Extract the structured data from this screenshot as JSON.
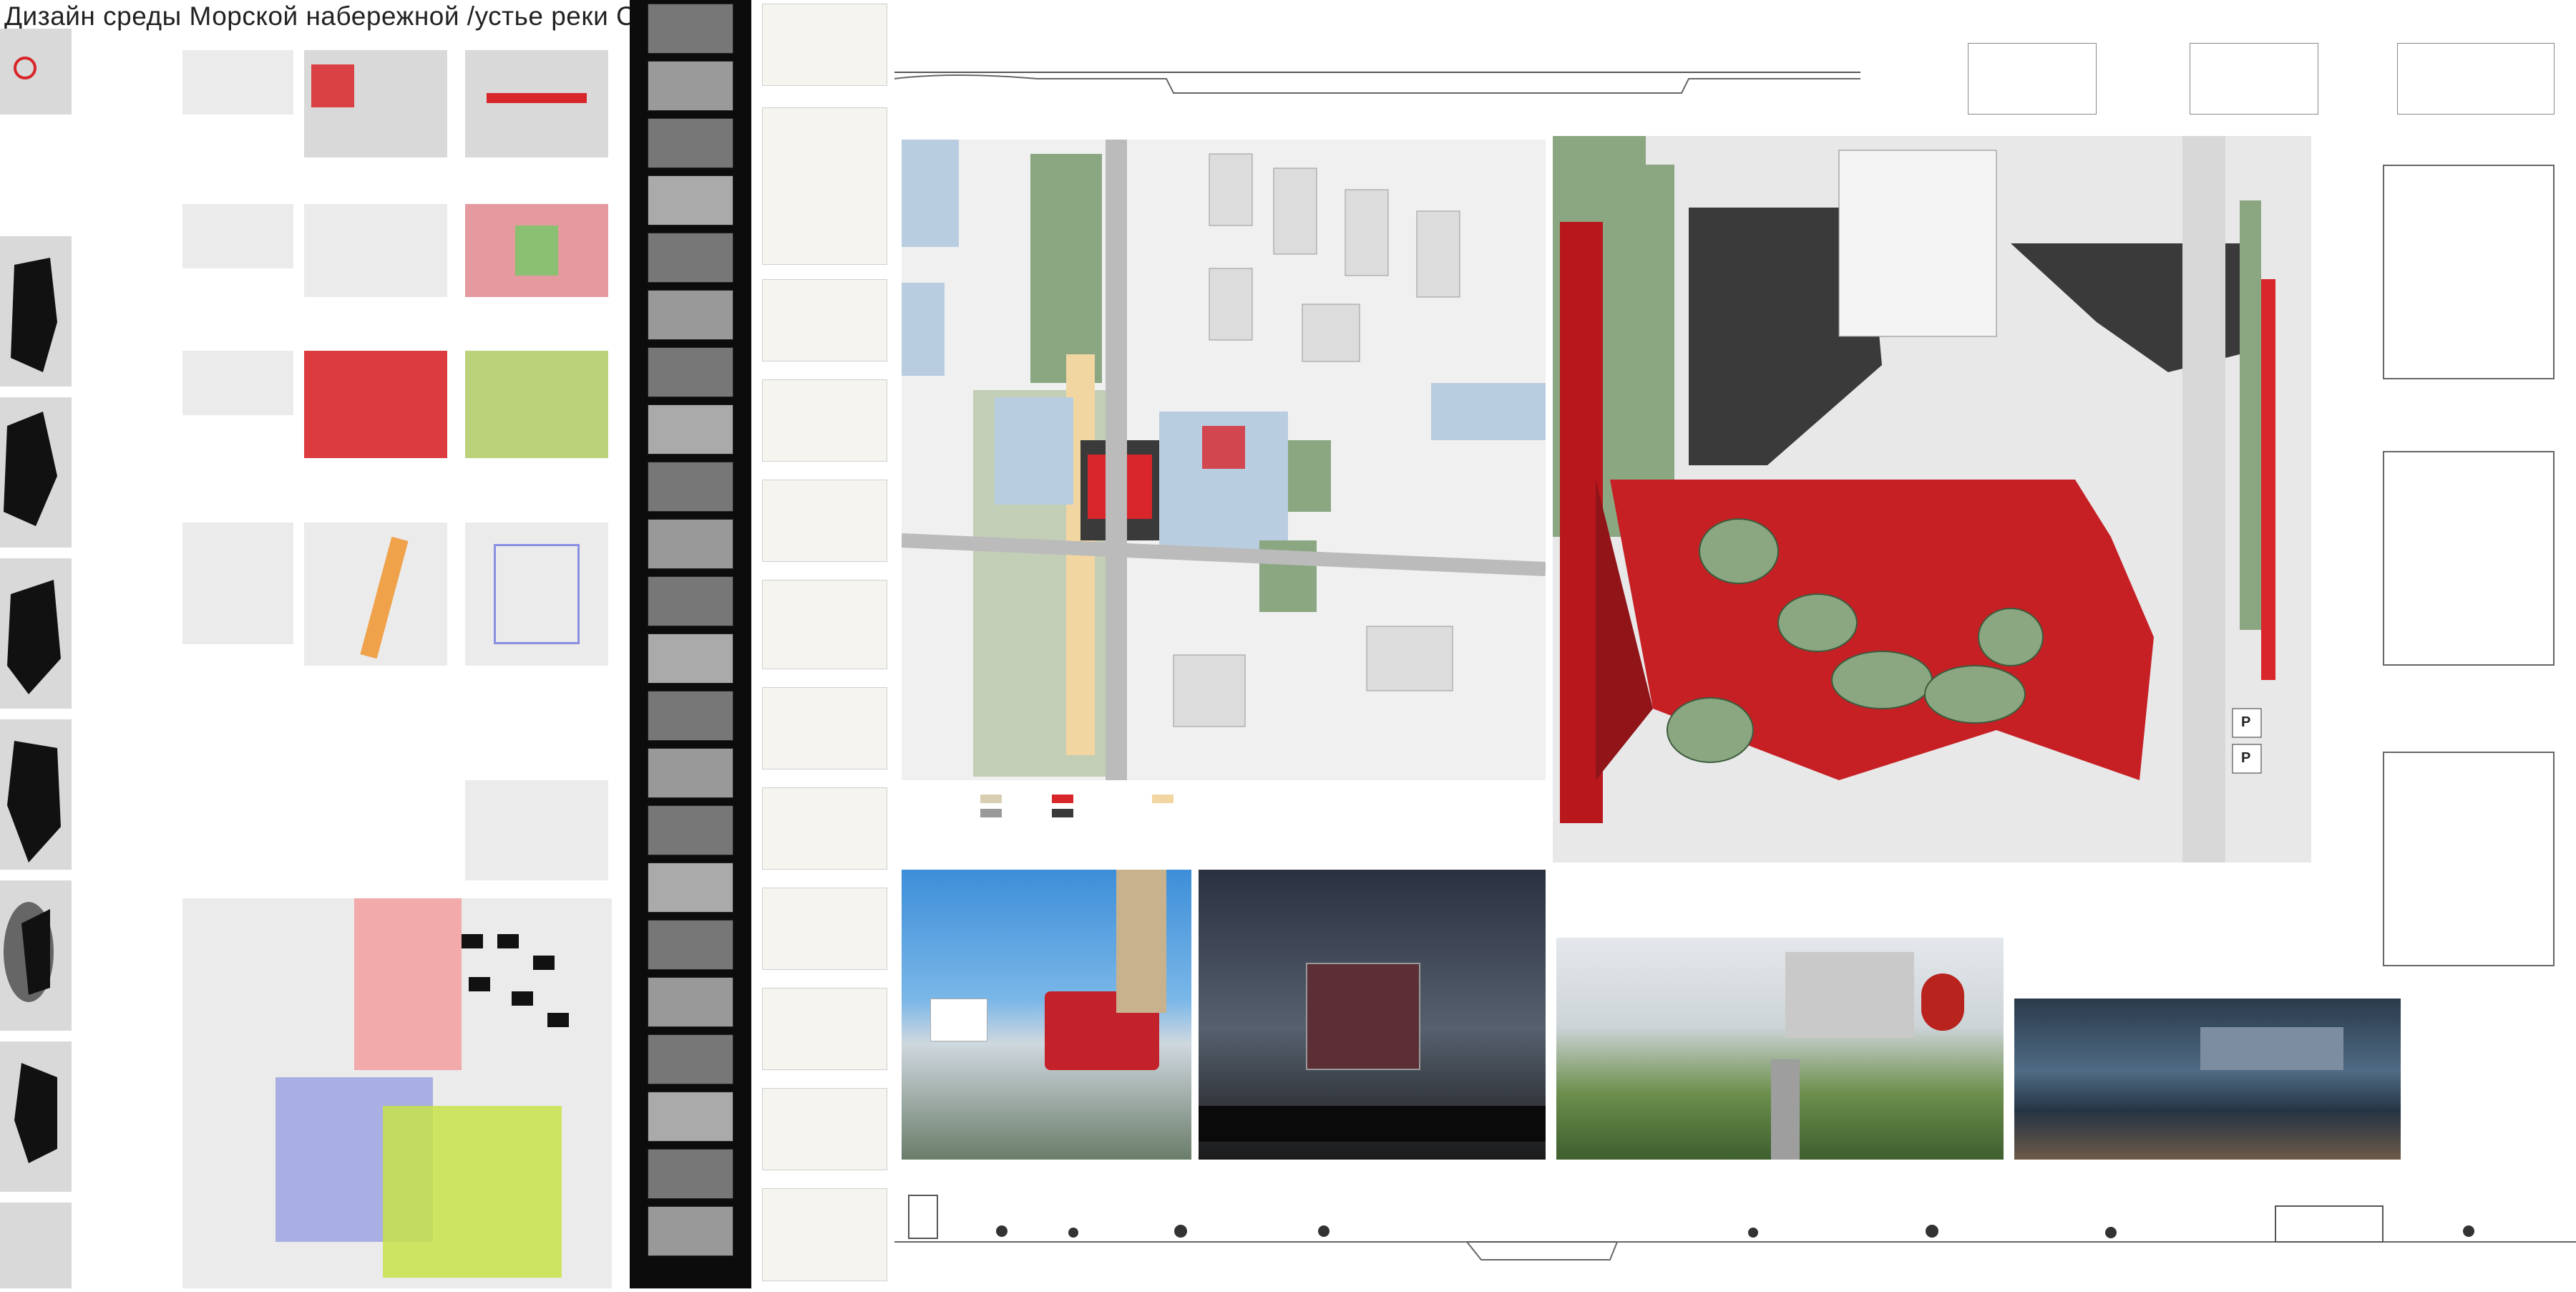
{
  "board": {
    "title": "Дизайн среды Морской набережной /устье реки Смоленки/",
    "parking_label_1": "P",
    "parking_label_2": "P"
  },
  "palette": {
    "accent_red": "#d8262a",
    "park_green": "#8aa782",
    "lime": "#c8e34a",
    "water_blue": "#b9cde0",
    "dark_gray": "#3a3a3a"
  }
}
